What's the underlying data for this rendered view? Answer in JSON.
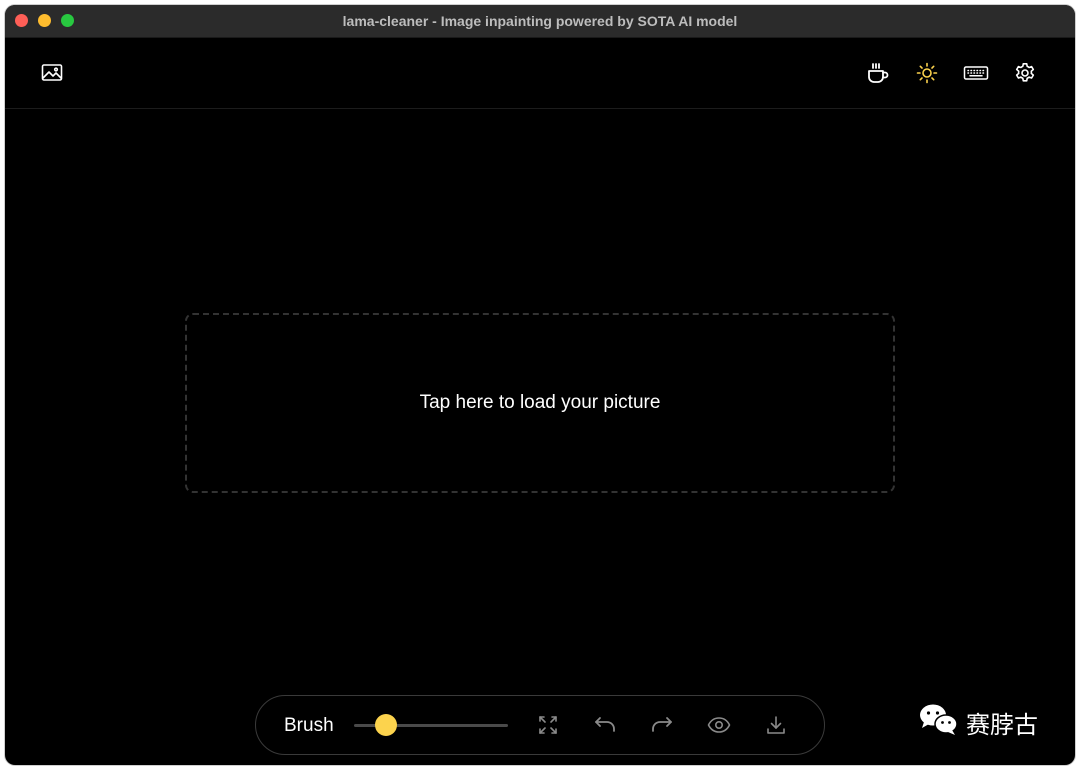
{
  "window": {
    "title": "lama-cleaner - Image inpainting powered by SOTA AI model"
  },
  "header": {
    "left_icons": [
      "image-icon"
    ],
    "right_icons": [
      "coffee-icon",
      "sun-icon",
      "keyboard-icon",
      "gear-icon"
    ]
  },
  "dropzone": {
    "text": "Tap here to load your picture"
  },
  "toolbar": {
    "brush_label": "Brush",
    "brush_size_fraction": 0.21,
    "icons": [
      "maximize-icon",
      "undo-icon",
      "redo-icon",
      "eye-icon",
      "download-icon"
    ]
  },
  "watermark": {
    "text": "赛脖古",
    "icon": "wechat-icon"
  },
  "colors": {
    "background": "#000000",
    "titlebar": "#2b2b2b",
    "accent_yellow": "#fcd34d",
    "text": "#ffffff",
    "muted_icon": "#8a8a8a"
  }
}
